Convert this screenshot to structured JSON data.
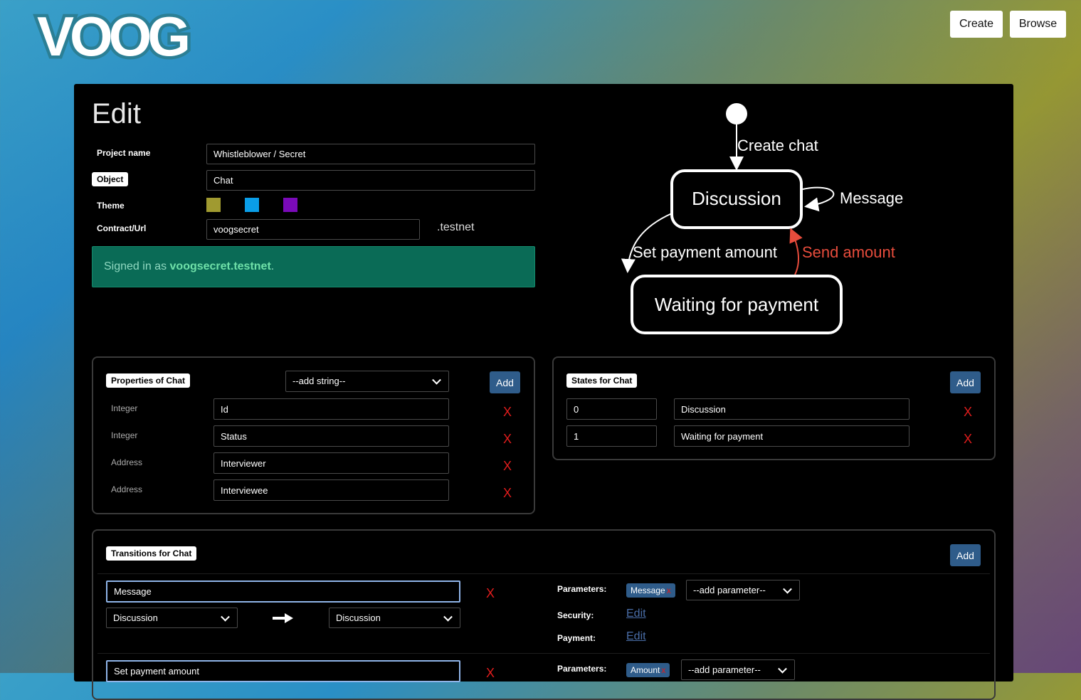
{
  "brand": {
    "logo_text": "VOOG"
  },
  "header": {
    "create_label": "Create",
    "browse_label": "Browse"
  },
  "page": {
    "title": "Edit"
  },
  "form": {
    "project_name_label": "Project name",
    "project_name_value": "Whistleblower / Secret",
    "object_label": "Object",
    "object_value": "Chat",
    "theme_label": "Theme",
    "theme_colors": [
      "#a09a30",
      "#0a9ee8",
      "#7a0ab8"
    ],
    "contract_label": "Contract/Url",
    "contract_value": "voogsecret",
    "contract_suffix": ".testnet"
  },
  "signed_in": {
    "prefix": "Signed in as ",
    "account": "voogsecret.testnet",
    "suffix": "."
  },
  "diagram": {
    "states": [
      "Discussion",
      "Waiting for payment"
    ],
    "edges": [
      {
        "label": "Create chat",
        "from": "start",
        "to": "Discussion"
      },
      {
        "label": "Message",
        "from": "Discussion",
        "to": "Discussion"
      },
      {
        "label": "Set payment amount",
        "from": "Discussion",
        "to": "Waiting for payment"
      },
      {
        "label": "Send amount",
        "from": "Waiting for payment",
        "to": "Discussion",
        "color": "#e74c3c"
      }
    ]
  },
  "properties": {
    "title": "Properties of Chat",
    "type_select": "--add string--",
    "add_label": "Add",
    "delete_label": "X",
    "items": [
      {
        "type": "Integer",
        "name": "Id"
      },
      {
        "type": "Integer",
        "name": "Status"
      },
      {
        "type": "Address",
        "name": "Interviewer"
      },
      {
        "type": "Address",
        "name": "Interviewee"
      }
    ]
  },
  "states": {
    "title": "States for Chat",
    "add_label": "Add",
    "delete_label": "X",
    "items": [
      {
        "id": "0",
        "name": "Discussion"
      },
      {
        "id": "1",
        "name": "Waiting for payment"
      }
    ]
  },
  "transitions": {
    "title": "Transitions for Chat",
    "add_label": "Add",
    "delete_label": "X",
    "parameters_label": "Parameters:",
    "security_label": "Security:",
    "payment_label": "Payment:",
    "edit_label": "Edit",
    "add_parameter": "--add parameter--",
    "items": [
      {
        "name": "Message",
        "from": "Discussion",
        "to": "Discussion",
        "param": "Message"
      },
      {
        "name": "Set payment amount",
        "param": "Amount"
      }
    ]
  }
}
